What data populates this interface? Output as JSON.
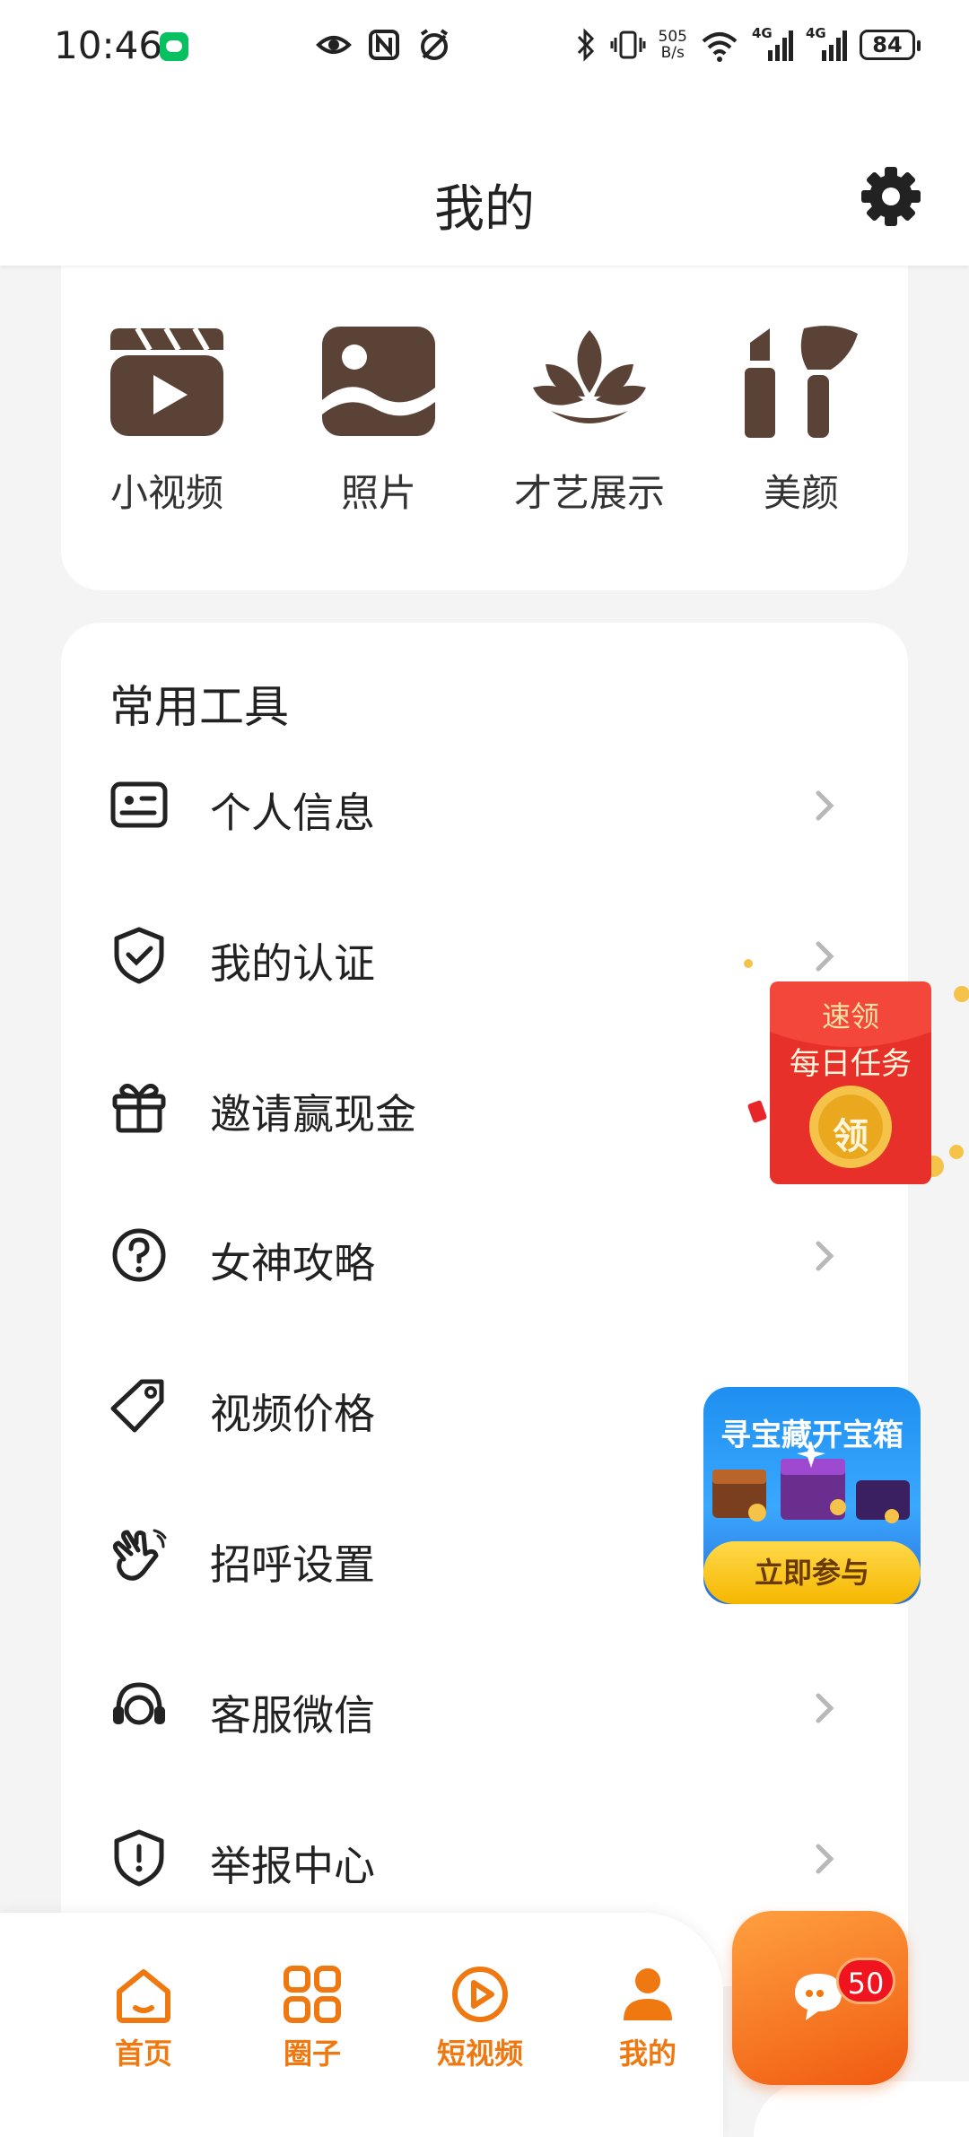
{
  "status_bar": {
    "time": "10:46",
    "speed_top": "505",
    "speed_bottom": "B/s",
    "network_1": "4G",
    "network_2": "4G",
    "battery": "84"
  },
  "header": {
    "title": "我的"
  },
  "media": [
    {
      "label": "小视频",
      "icon": "clapperboard-icon"
    },
    {
      "label": "照片",
      "icon": "photo-icon"
    },
    {
      "label": "才艺展示",
      "icon": "lotus-icon"
    },
    {
      "label": "美颜",
      "icon": "makeup-icon"
    }
  ],
  "tools": {
    "title": "常用工具",
    "items": [
      {
        "label": "个人信息",
        "icon": "id-card-icon"
      },
      {
        "label": "我的认证",
        "icon": "shield-check-icon"
      },
      {
        "label": "邀请赢现金",
        "icon": "gift-icon"
      },
      {
        "label": "女神攻略",
        "icon": "question-circle-icon"
      },
      {
        "label": "视频价格",
        "icon": "price-tag-icon"
      },
      {
        "label": "招呼设置",
        "icon": "wave-hand-icon"
      },
      {
        "label": "客服微信",
        "icon": "headset-icon"
      },
      {
        "label": "举报中心",
        "icon": "shield-alert-icon"
      }
    ]
  },
  "promo_redpacket": {
    "line1": "速领",
    "line2": "每日任务",
    "coin": "领"
  },
  "promo_treasure": {
    "title": "寻宝藏开宝箱",
    "button": "立即参与"
  },
  "bottom_nav": {
    "items": [
      {
        "label": "首页",
        "icon": "home-icon"
      },
      {
        "label": "圈子",
        "icon": "grid-icon"
      },
      {
        "label": "短视频",
        "icon": "play-icon"
      },
      {
        "label": "我的",
        "icon": "person-icon",
        "active": true
      }
    ],
    "chat_badge": "50"
  },
  "colors": {
    "accent": "#f07810",
    "icon_brown": "#5a4236",
    "badge_red": "#f0141e"
  }
}
